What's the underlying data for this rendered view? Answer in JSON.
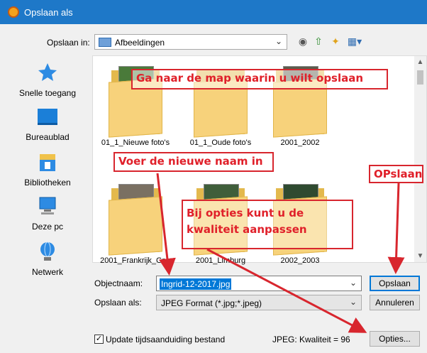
{
  "window": {
    "title": "Opslaan als"
  },
  "toolbar": {
    "save_in_label": "Opslaan in:",
    "save_in_value": "Afbeeldingen",
    "icons": [
      "back-icon",
      "up-folder-icon",
      "new-folder-icon",
      "view-menu-icon"
    ]
  },
  "places": [
    {
      "label": "Snelle toegang",
      "icon": "star-icon"
    },
    {
      "label": "Bureaublad",
      "icon": "desktop-icon"
    },
    {
      "label": "Bibliotheken",
      "icon": "library-icon"
    },
    {
      "label": "Deze pc",
      "icon": "computer-icon"
    },
    {
      "label": "Netwerk",
      "icon": "network-icon"
    }
  ],
  "folders": [
    {
      "name": "01_1_Nieuwe foto's"
    },
    {
      "name": "01_1_Oude foto's"
    },
    {
      "name": "2001_2002"
    },
    {
      "name": "2001_Frankrijk_Gr..."
    },
    {
      "name": "2001_Limburg"
    },
    {
      "name": "2002_2003"
    }
  ],
  "form": {
    "filename_label": "Objectnaam:",
    "filename_value": "Ingrid-12-2017.jpg",
    "filetype_label": "Opslaan als:",
    "filetype_value": "JPEG Format (*.jpg;*.jpeg)",
    "save_button": "Opslaan",
    "cancel_button": "Annuleren",
    "options_button": "Opties...",
    "checkbox_label": "Update tijdsaanduiding bestand",
    "checkbox_checked": true,
    "quality_text": "JPEG: Kwaliteit = 96"
  },
  "annotations": {
    "navigate": "Ga naar de map waarin u wilt opslaan",
    "enter_name": "Voer de nieuwe naam in",
    "save": "OPslaan",
    "options": "Bij opties kunt u de kwaliteit aanpassen"
  },
  "colors": {
    "titlebar": "#1e78c8",
    "annotation": "#d8262e",
    "selection": "#0078d7"
  }
}
